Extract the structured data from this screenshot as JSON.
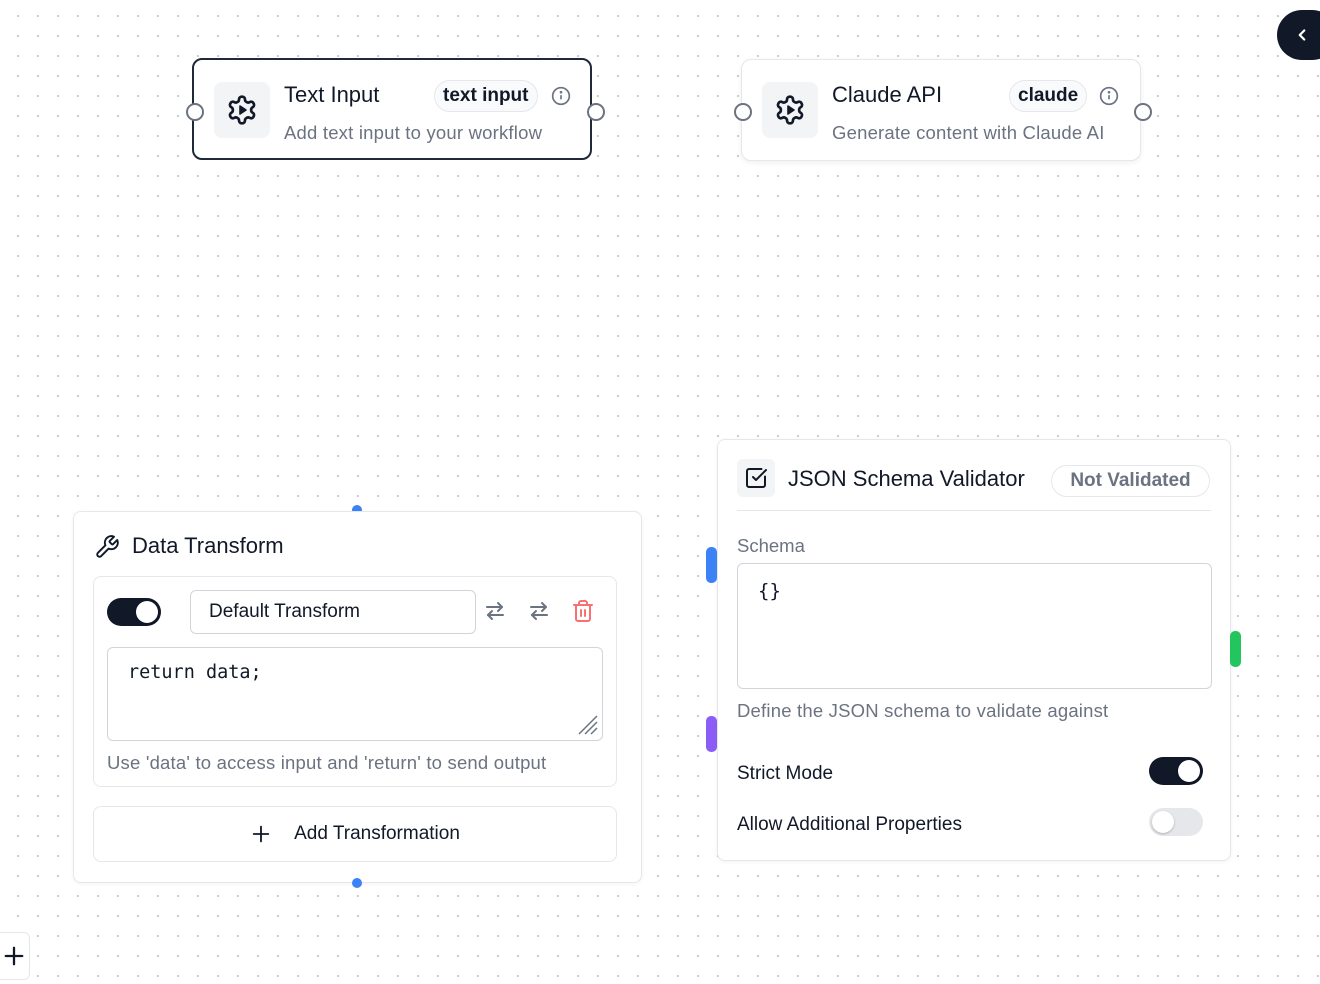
{
  "nodes": {
    "text_input": {
      "title": "Text Input",
      "badge": "text input",
      "description": "Add text input to your workflow",
      "icon": "gear-icon",
      "selected": true
    },
    "claude_api": {
      "title": "Claude API",
      "badge": "claude",
      "description": "Generate content with Claude AI",
      "icon": "gear-icon",
      "selected": false
    },
    "data_transform": {
      "title": "Data Transform",
      "icon": "wrench-icon",
      "transform": {
        "enabled": true,
        "name": "Default Transform",
        "code": "return data;",
        "hint": "Use 'data' to access input and 'return' to send output"
      },
      "add_button_label": "Add Transformation"
    },
    "json_validator": {
      "title": "JSON Schema Validator",
      "icon": "checkbox-icon",
      "status": "Not Validated",
      "schema_label": "Schema",
      "schema_value": "{}",
      "schema_help": "Define the JSON schema to validate against",
      "strict_mode_label": "Strict Mode",
      "strict_mode": true,
      "allow_additional_label": "Allow Additional Properties",
      "allow_additional": false
    }
  },
  "colors": {
    "handle_blue": "#3b82f6",
    "handle_purple": "#8b5cf6",
    "handle_green": "#22c55e",
    "delete_red": "#f87171",
    "dark": "#111827"
  },
  "controls": {
    "panel_toggle_icon": "chevron-left-icon",
    "corner_add_icon": "plus-icon"
  }
}
